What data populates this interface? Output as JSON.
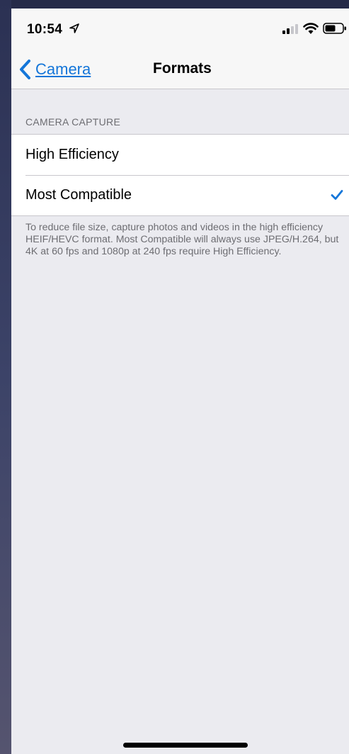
{
  "status_bar": {
    "time": "10:54",
    "location_icon": "location-arrow-icon",
    "signal_icon": "cellular-signal-icon",
    "wifi_icon": "wifi-icon",
    "battery_icon": "battery-icon"
  },
  "nav": {
    "back_label": "Camera",
    "title": "Formats"
  },
  "section": {
    "header": "CAMERA CAPTURE",
    "options": [
      {
        "label": "High Efficiency",
        "selected": false
      },
      {
        "label": "Most Compatible",
        "selected": true
      }
    ],
    "footer": "To reduce file size, capture photos and videos in the high efficiency HEIF/HEVC format. Most Compatible will always use JPEG/H.264, but 4K at 60 fps and 1080p at 240 fps require High Efficiency."
  },
  "colors": {
    "accent": "#1476d9",
    "background": "#ebebf0",
    "secondary_text": "#6d6d72"
  }
}
